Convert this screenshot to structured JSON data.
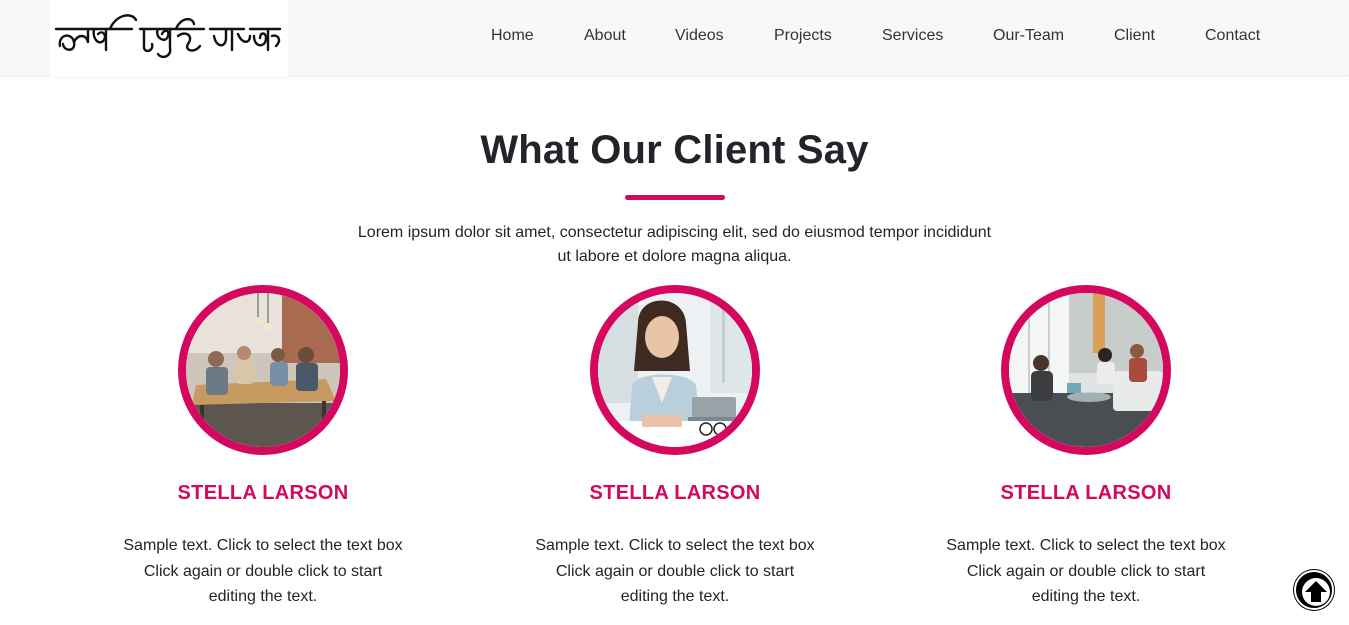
{
  "header": {
    "logo_text": "আমি কিন্তু মহা খাদক",
    "nav": [
      "Home",
      "About",
      "Videos",
      "Projects",
      "Services",
      "Our-Team",
      "Client",
      "Contact"
    ]
  },
  "client_section": {
    "title": "What Our Client Say",
    "description_line1": "Lorem ipsum dolor sit amet, consectetur adipiscing elit, sed do eiusmod tempor incididunt",
    "description_line2": "ut labore et dolore magna aliqua.",
    "cards": [
      {
        "name": "STELLA LARSON",
        "text_line1": "Sample text. Click to select the text box",
        "text_line2": "Click again or double click to start",
        "text_line3": "editing the text."
      },
      {
        "name": "STELLA LARSON",
        "text_line1": "Sample text. Click to select the text box",
        "text_line2": "Click again or double click to start",
        "text_line3": "editing the text."
      },
      {
        "name": "STELLA LARSON",
        "text_line1": "Sample text. Click to select the text box",
        "text_line2": "Click again or double click to start",
        "text_line3": "editing the text."
      }
    ]
  },
  "scroll_top": {
    "icon": "arrow-up-circle-icon"
  },
  "colors": {
    "accent": "#d4085e",
    "heading": "#212529",
    "nav_bg": "#f8f8f8"
  }
}
